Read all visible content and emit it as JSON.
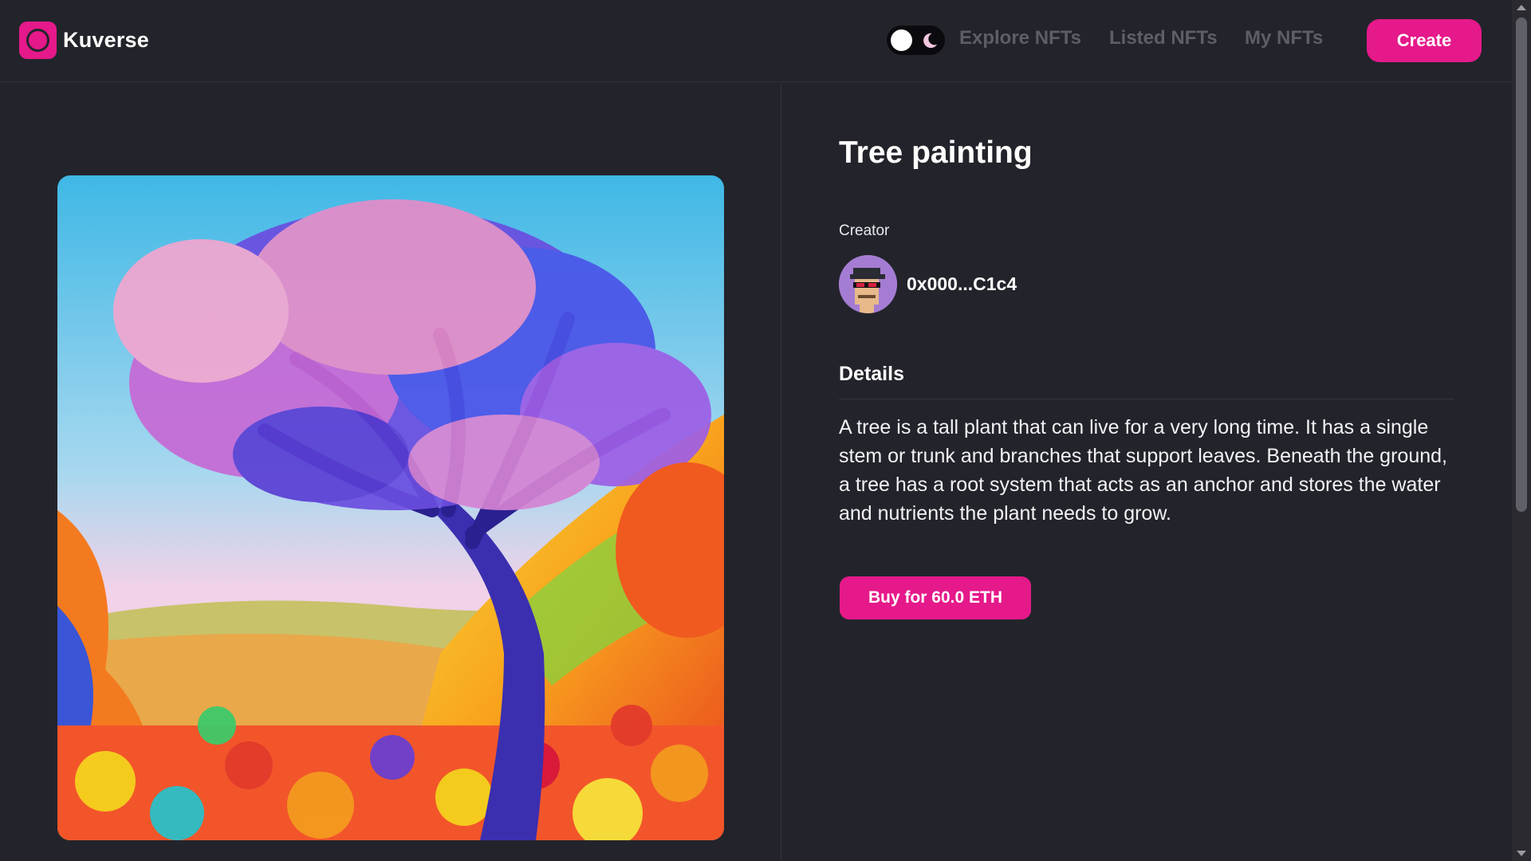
{
  "brand": {
    "name": "Kuverse",
    "logo_icon": "ring-logo-icon",
    "accent_color": "#e5198a"
  },
  "header": {
    "theme_toggle": {
      "icons": [
        "sun-knob-icon",
        "moon-icon"
      ],
      "mode": "dark"
    },
    "nav": [
      {
        "label": "Explore NFTs"
      },
      {
        "label": "Listed NFTs"
      },
      {
        "label": "My NFTs"
      }
    ],
    "create_label": "Create"
  },
  "nft": {
    "artwork_icon": "tree-painting-image",
    "title": "Tree painting",
    "creator_label": "Creator",
    "creator_address": "0x000...C1c4",
    "creator_avatar_icon": "pixel-avatar-icon",
    "details_heading": "Details",
    "description": "A tree is a tall plant that can live for a very long time. It has a single stem or trunk and branches that support leaves. Beneath the ground, a tree has a root system that acts as an anchor and stores the water and nutrients the plant needs to grow.",
    "buy_label": "Buy for 60.0 ETH"
  },
  "colors": {
    "background": "#23242b",
    "nav_inactive": "#5d5e66",
    "text": "#ffffff"
  }
}
